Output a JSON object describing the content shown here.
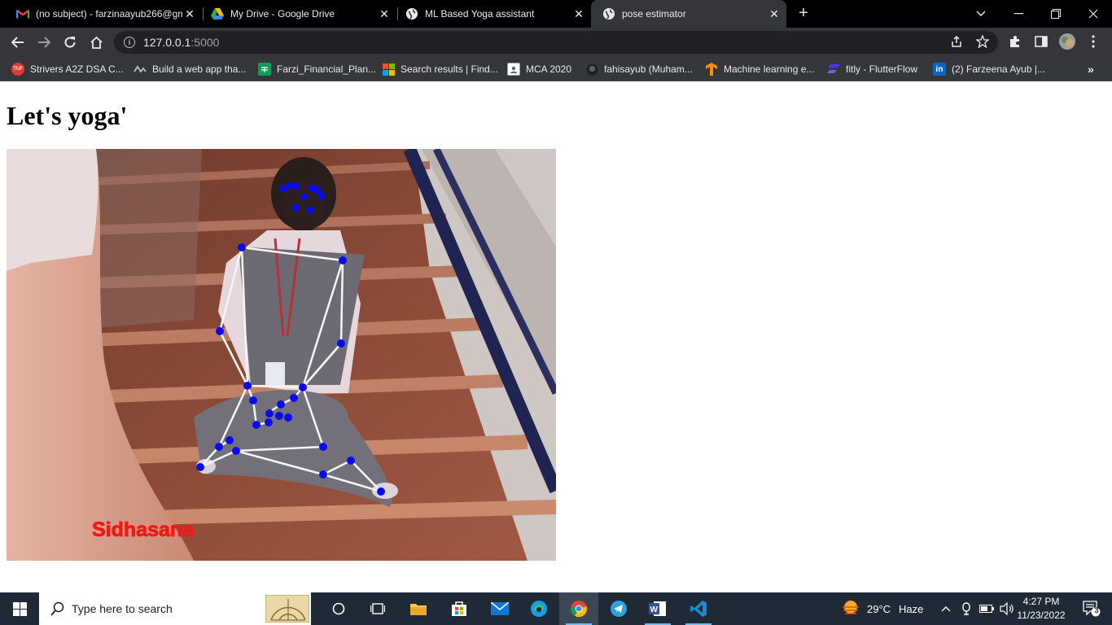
{
  "browser": {
    "tabs": [
      {
        "title": "(no subject) - farzinaayub266@gma",
        "icon": "gmail-icon",
        "active": false
      },
      {
        "title": "My Drive - Google Drive",
        "icon": "google-drive-icon",
        "active": false
      },
      {
        "title": "ML Based Yoga assistant",
        "icon": "globe-icon",
        "active": false
      },
      {
        "title": "pose estimator",
        "icon": "globe-icon",
        "active": true
      }
    ],
    "address": {
      "host": "127.0.0.1",
      "port": ":5000"
    },
    "bookmarks": [
      {
        "label": "Strivers A2Z DSA C...",
        "icon": "tuf-icon",
        "color": "#e53935"
      },
      {
        "label": "Build a web app tha...",
        "icon": "streamlit-icon",
        "color": "#35363a"
      },
      {
        "label": "Farzi_Financial_Plan...",
        "icon": "sheets-icon",
        "color": "#0f9d58"
      },
      {
        "label": "Search results | Find...",
        "icon": "microsoft-icon",
        "color": "#f25022"
      },
      {
        "label": "MCA 2020",
        "icon": "classroom-icon",
        "color": "#ffffff"
      },
      {
        "label": "fahisayub (Muham...",
        "icon": "github-icon",
        "color": "#35363a"
      },
      {
        "label": "Machine learning e...",
        "icon": "tensorflow-icon",
        "color": "#ff8f00"
      },
      {
        "label": "fitly - FlutterFlow",
        "icon": "flutterflow-icon",
        "color": "#4b39ef"
      },
      {
        "label": "(2) Farzeena Ayub |...",
        "icon": "linkedin-icon",
        "color": "#0a66c2"
      }
    ]
  },
  "page": {
    "heading": "Let's yoga'",
    "pose_label": "Sidhasana"
  },
  "taskbar": {
    "search_placeholder": "Type here to search",
    "weather": {
      "temp": "29°C",
      "condition": "Haze"
    },
    "clock": {
      "time": "4:27 PM",
      "date": "11/23/2022"
    },
    "notification_count": "3"
  }
}
